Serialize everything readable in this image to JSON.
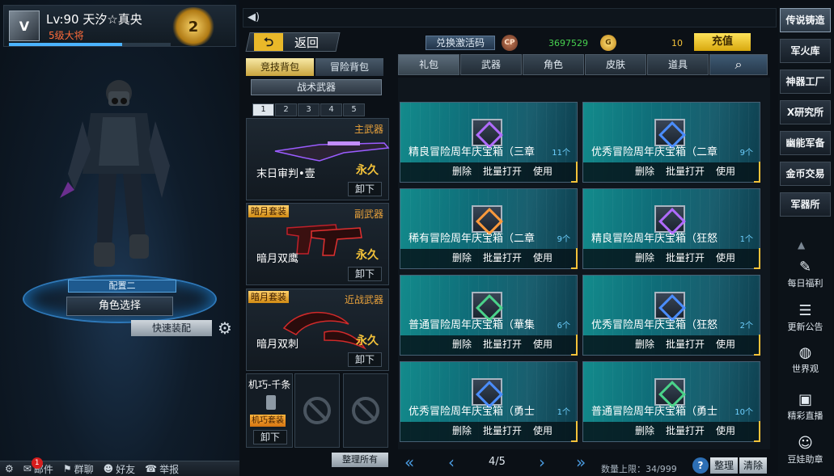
{
  "profile": {
    "name": "Lv:90 天汐☆真央",
    "rank": "5级大将",
    "exp_fraction": 0.7,
    "avatar_text": "V",
    "badge_text": "2"
  },
  "character": {
    "config_label": "配置二",
    "role_select": "角色选择",
    "quick_equip": "快速装配"
  },
  "bottom_bar": {
    "mail": "邮件",
    "mail_count": "1",
    "group": "群聊",
    "friends": "好友",
    "report": "举报"
  },
  "backpack": {
    "back_label": "返回",
    "tabs": [
      "竞技背包",
      "冒险背包"
    ],
    "tactic_button": "战术武器",
    "slots": [
      "1",
      "2",
      "3",
      "4",
      "5"
    ],
    "weapons": [
      {
        "category": "主武器",
        "name": "末日审判•壹",
        "duration": "永久",
        "unequip": "卸下",
        "tag": ""
      },
      {
        "category": "副武器",
        "name": "暗月双鹰",
        "duration": "永久",
        "unequip": "卸下",
        "tag": "暗月套装"
      },
      {
        "category": "近战武器",
        "name": "暗月双刺",
        "duration": "永久",
        "unequip": "卸下",
        "tag": "暗月套装"
      }
    ],
    "gadget": {
      "name": "机巧-千条",
      "tag": "机巧套装",
      "unequip": "卸下"
    },
    "tidy_all": "整理所有"
  },
  "shop": {
    "redeem": "兑换激活码",
    "cp_label": "CP",
    "cp_value": "3697529",
    "gold_label": "G",
    "gold_value": "10",
    "recharge": "充值",
    "tabs": [
      "礼包",
      "武器",
      "角色",
      "皮肤",
      "道具"
    ],
    "search_icon": "search-icon",
    "action_delete": "删除",
    "action_batch": "批量打开",
    "action_use": "使用",
    "items": [
      {
        "name": "精良冒险周年庆宝箱（三章",
        "qty": "11个",
        "color": "#b06bff"
      },
      {
        "name": "优秀冒险周年庆宝箱（二章",
        "qty": "9个",
        "color": "#4a8dff"
      },
      {
        "name": "稀有冒险周年庆宝箱（二章",
        "qty": "9个",
        "color": "#ff9a3c"
      },
      {
        "name": "精良冒险周年庆宝箱（狂怒",
        "qty": "1个",
        "color": "#b06bff"
      },
      {
        "name": "普通冒险周年庆宝箱（華集",
        "qty": "6个",
        "color": "#4ad38a"
      },
      {
        "name": "优秀冒险周年庆宝箱（狂怒",
        "qty": "2个",
        "color": "#4a8dff"
      },
      {
        "name": "优秀冒险周年庆宝箱（勇士",
        "qty": "1个",
        "color": "#4a8dff"
      },
      {
        "name": "普通冒险周年庆宝箱（勇士",
        "qty": "10个",
        "color": "#4ad38a"
      }
    ],
    "pager": {
      "page": "4/5",
      "qty_limit": "数量上限：34/999",
      "help": "?",
      "sort": "整理",
      "clear": "清除"
    }
  },
  "right_nav": {
    "buttons": [
      "传说铸造",
      "军火库",
      "神器工厂",
      "X研究所",
      "幽能军备",
      "金币交易",
      "军器所"
    ],
    "links": [
      "每日福利",
      "更新公告",
      "世界观",
      "精彩直播",
      "豆娃助章"
    ]
  }
}
